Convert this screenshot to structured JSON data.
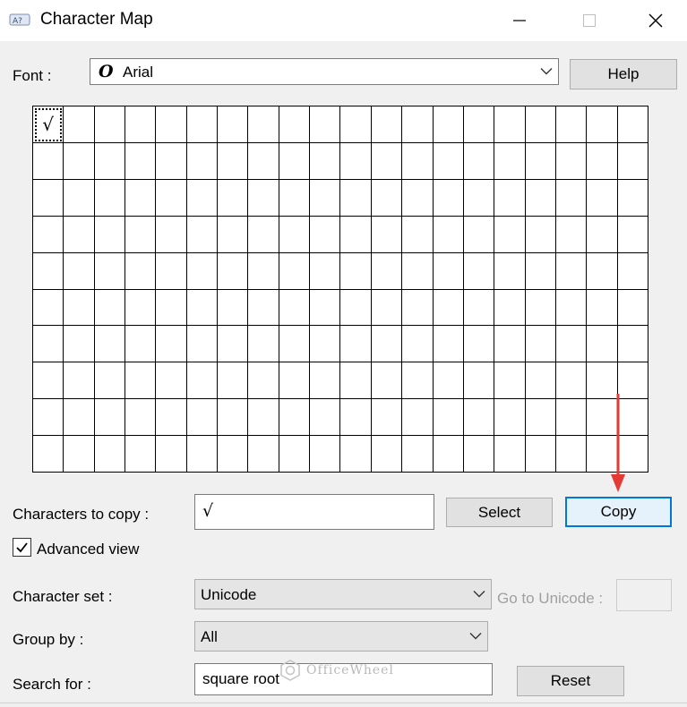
{
  "window": {
    "title": "Character Map",
    "icons": {
      "app": "charmap-app-icon",
      "minimize": "minimize-icon",
      "maximize": "maximize-icon",
      "close": "close-icon"
    }
  },
  "font": {
    "label": "Font :",
    "selected": "Arial",
    "icon": "opentype-font-icon"
  },
  "help_label": "Help",
  "grid": {
    "rows": 10,
    "columns": 20,
    "selected_char": "√"
  },
  "chars_to_copy": {
    "label": "Characters to copy :",
    "value": "√"
  },
  "select_label": "Select",
  "copy_label": "Copy",
  "advanced_view": {
    "label": "Advanced view",
    "checked": true
  },
  "character_set": {
    "label": "Character set :",
    "selected": "Unicode"
  },
  "go_to_unicode": {
    "label": "Go to Unicode :",
    "value": ""
  },
  "group_by": {
    "label": "Group by :",
    "selected": "All"
  },
  "search_for": {
    "label": "Search for :",
    "value": "square root"
  },
  "reset_label": "Reset",
  "watermark": {
    "text": "OfficeWheel"
  },
  "colors": {
    "accent": "#0078d7",
    "arrow": "#e53935"
  }
}
